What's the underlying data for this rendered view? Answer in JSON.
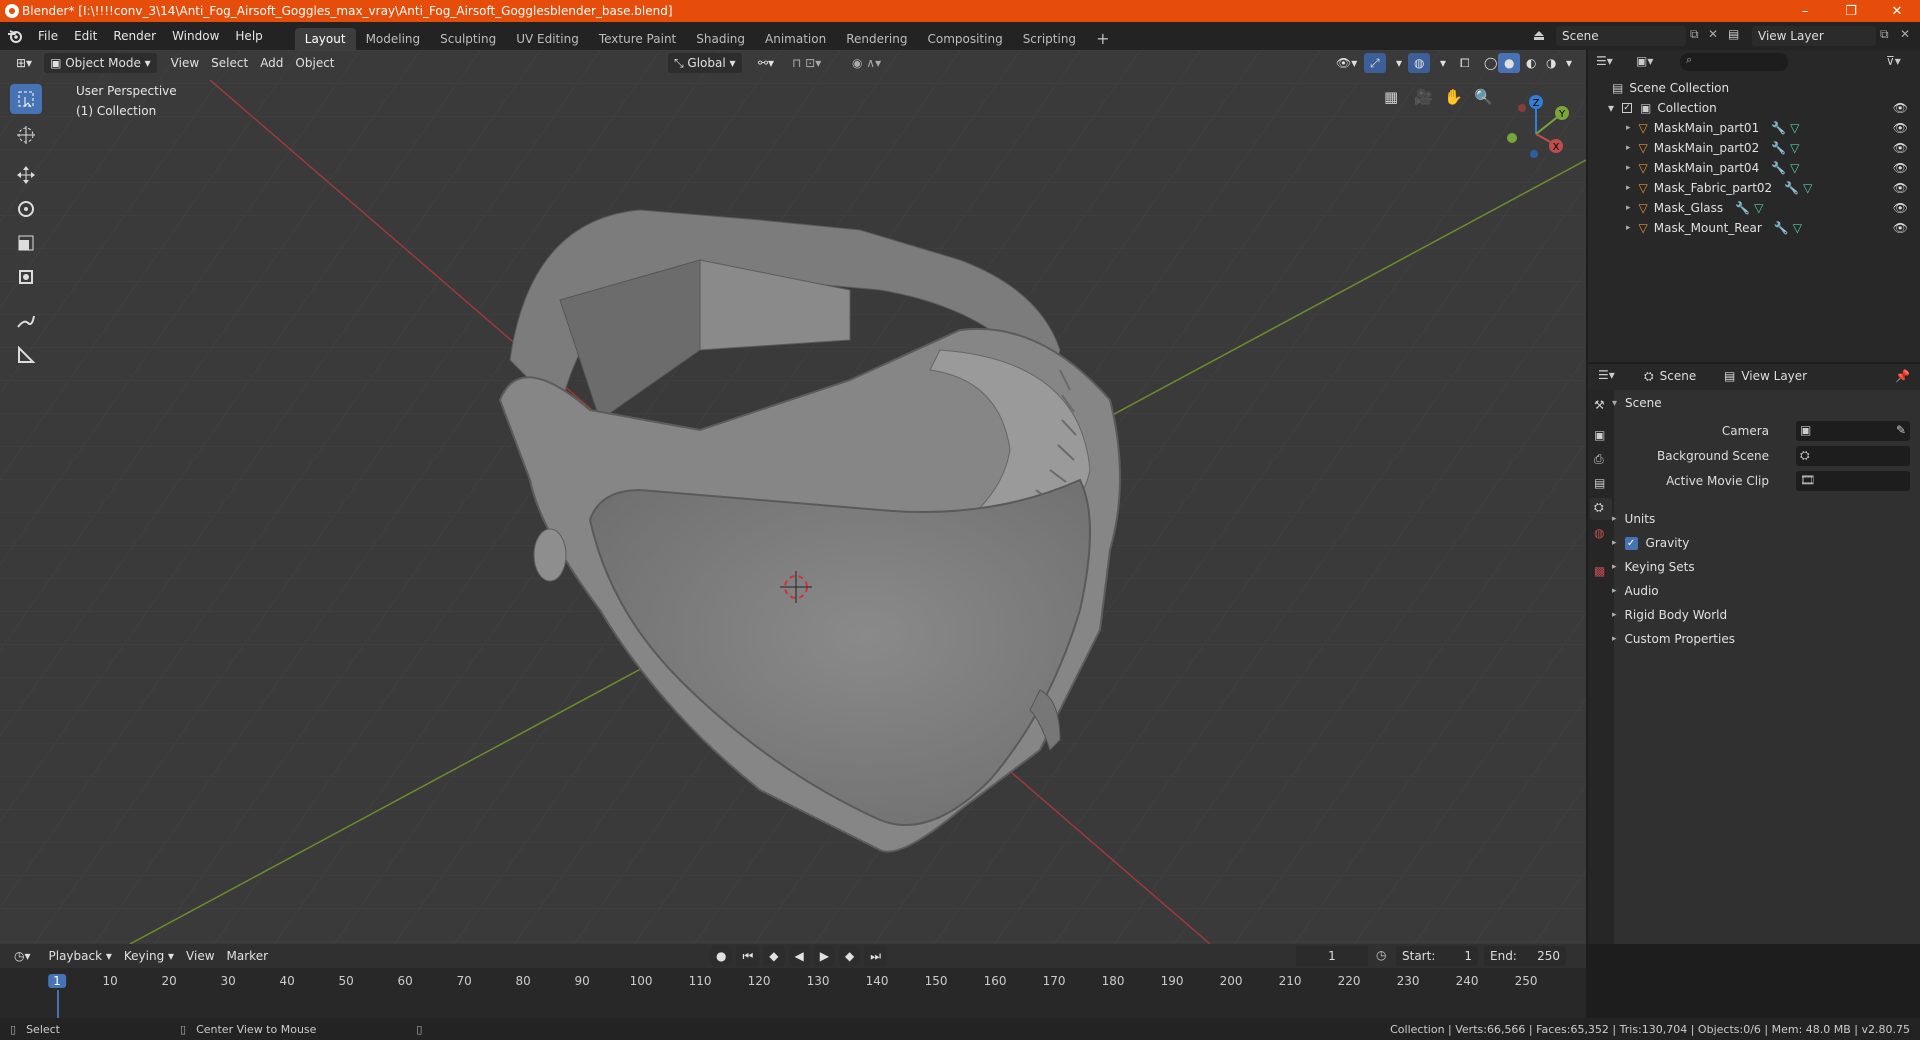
{
  "window": {
    "title": "Blender* [I:\\!!!!conv_3\\14\\Anti_Fog_Airsoft_Goggles_max_vray\\Anti_Fog_Airsoft_Gogglesblender_base.blend]",
    "minimize": "–",
    "maximize": "❐",
    "close": "✕"
  },
  "menu": [
    "File",
    "Edit",
    "Render",
    "Window",
    "Help"
  ],
  "workspaces": [
    "Layout",
    "Modeling",
    "Sculpting",
    "UV Editing",
    "Texture Paint",
    "Shading",
    "Animation",
    "Rendering",
    "Compositing",
    "Scripting"
  ],
  "scene_field": "Scene",
  "viewlayer_field": "View Layer",
  "viewport": {
    "mode": "Object Mode",
    "menus": [
      "View",
      "Select",
      "Add",
      "Object"
    ],
    "orientation": "Global",
    "overlay_line1": "User Perspective",
    "overlay_line2": "(1) Collection",
    "gizmo": {
      "z": "Z",
      "y": "Y",
      "x": "X"
    }
  },
  "outliner": {
    "root": "Scene Collection",
    "collection": "Collection",
    "items": [
      "MaskMain_part01",
      "MaskMain_part02",
      "MaskMain_part04",
      "Mask_Fabric_part02",
      "Mask_Glass",
      "Mask_Mount_Rear"
    ]
  },
  "properties": {
    "tab_scene": "Scene",
    "tab_viewlayer": "View Layer",
    "section": "Scene",
    "camera_label": "Camera",
    "bgscene_label": "Background Scene",
    "movieclip_label": "Active Movie Clip",
    "panels": [
      "Units",
      "Gravity",
      "Keying Sets",
      "Audio",
      "Rigid Body World",
      "Custom Properties"
    ],
    "gravity_checked": true
  },
  "timeline": {
    "menus": [
      "Playback",
      "Keying",
      "View",
      "Marker"
    ],
    "current_frame": "1",
    "start_label": "Start:",
    "start": "1",
    "end_label": "End:",
    "end": "250",
    "ticks": [
      "1",
      "10",
      "20",
      "30",
      "40",
      "50",
      "60",
      "70",
      "80",
      "90",
      "100",
      "110",
      "120",
      "130",
      "140",
      "150",
      "160",
      "170",
      "180",
      "190",
      "200",
      "210",
      "220",
      "230",
      "240",
      "250"
    ]
  },
  "status": {
    "left_action": "Select",
    "mid_action": "Center View to Mouse",
    "stats": "Collection | Verts:66,566 | Faces:65,352 | Tris:130,704 | Objects:0/6 | Mem: 48.0 MB | v2.80.75"
  },
  "colors": {
    "accent": "#4772b3",
    "title_bar": "#e64c0a",
    "x_axis": "#c04d4d",
    "y_axis": "#7aa53a",
    "z_axis": "#2f7fd6"
  }
}
